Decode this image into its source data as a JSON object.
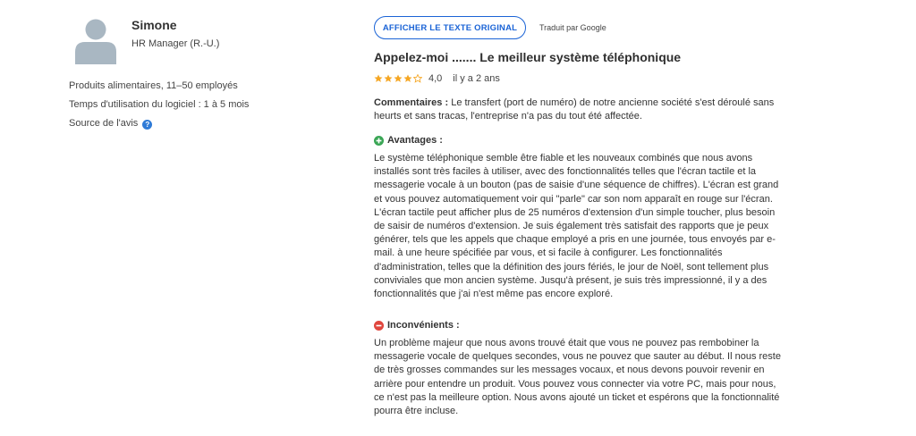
{
  "reviewer": {
    "name": "Simone",
    "role": "HR Manager (R.-U.)",
    "company": "Produits alimentaires, 11–50 employés",
    "usage": "Temps d'utilisation du logiciel : 1 à 5 mois",
    "source_label": "Source de l'avis",
    "help_glyph": "?"
  },
  "translation": {
    "show_original_label": "AFFICHER LE TEXTE ORIGINAL",
    "translated_by": "Traduit par Google"
  },
  "review": {
    "title": "Appelez-moi ....... Le meilleur système téléphonique",
    "rating": 4.0,
    "rating_text": "4,0",
    "max_rating": 5,
    "age": "il y a 2 ans",
    "comments_label": "Commentaires :",
    "comments_text": " Le transfert (port de numéro) de notre ancienne société s'est déroulé sans heurts et sans tracas, l'entreprise n'a pas du tout été affectée.",
    "pros_label": "Avantages :",
    "pros_text": "Le système téléphonique semble être fiable et les nouveaux combinés que nous avons installés sont très faciles à utiliser, avec des fonctionnalités telles que l'écran tactile et la messagerie vocale à un bouton (pas de saisie d'une séquence de chiffres). L'écran est grand et vous pouvez automatiquement voir qui \"parle\" car son nom apparaît en rouge sur l'écran. L'écran tactile peut afficher plus de 25 numéros d'extension d'un simple toucher, plus besoin de saisir de numéros d'extension. Je suis également très satisfait des rapports que je peux générer, tels que les appels que chaque employé a pris en une journée, tous envoyés par e-mail. à une heure spécifiée par vous, et si facile à configurer. Les fonctionnalités d'administration, telles que la définition des jours fériés, le jour de Noël, sont tellement plus conviviales que mon ancien système. Jusqu'à présent, je suis très impressionné, il y a des fonctionnalités que j'ai n'est même pas encore exploré.",
    "cons_label": "Inconvénients :",
    "cons_text": "Un problème majeur que nous avons trouvé était que vous ne pouvez pas rembobiner la messagerie vocale de quelques secondes, vous ne pouvez que sauter au début. Il nous reste de très grosses commandes sur les messages vocaux, et nous devons pouvoir revenir en arrière pour entendre un produit. Vous pouvez vous connecter via votre PC, mais pour nous, ce n'est pas la meilleure option. Nous avons ajouté un ticket et espérons que la fonctionnalité pourra être incluse."
  },
  "colors": {
    "accent": "#1a63d6",
    "star": "#f5a623",
    "star_empty": "#f5a623",
    "pros_icon": "#3aa655",
    "cons_icon": "#e0463e",
    "avatar": "#a9b7c2",
    "help_icon": "#2f7bd7"
  },
  "icons": {
    "avatar": "user-silhouette-icon",
    "help": "help-circle-icon",
    "star": "star-icon",
    "pros": "plus-circle-icon",
    "cons": "minus-circle-icon"
  }
}
